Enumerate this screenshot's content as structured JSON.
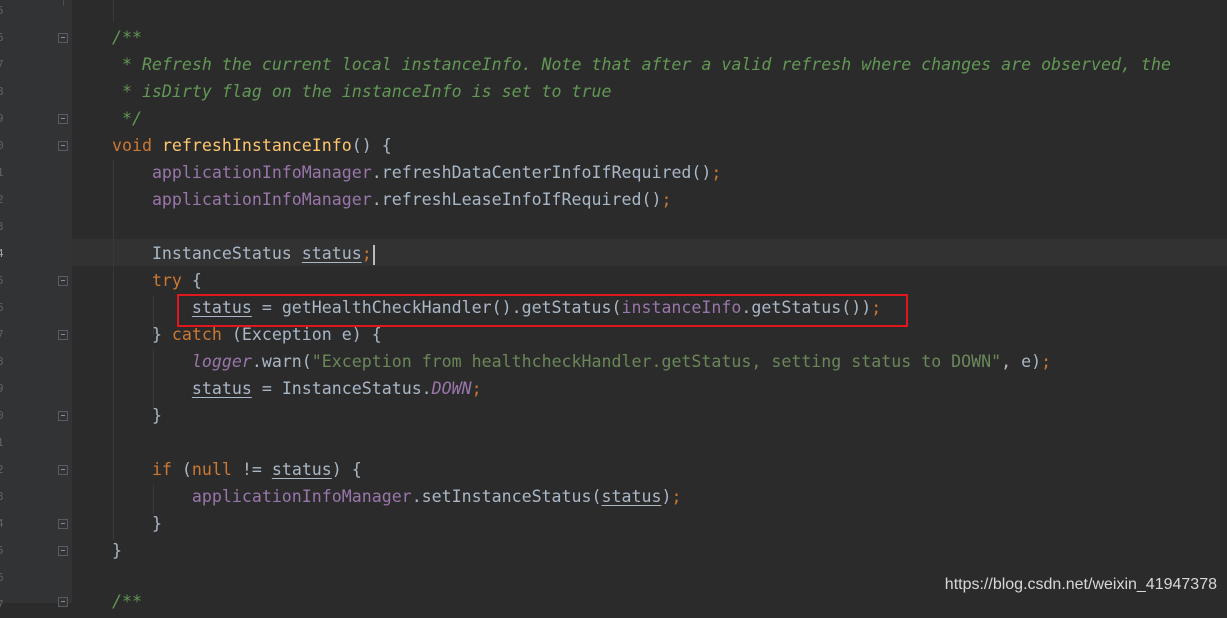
{
  "editor": {
    "gutter_numbers": [
      "5",
      "6",
      "7",
      "8",
      "9",
      "0",
      "1",
      "2",
      "3",
      "4",
      "5",
      "6",
      "7",
      "8",
      "9",
      "0",
      "1",
      "2",
      "3",
      "4",
      "5",
      "6",
      "7"
    ],
    "code": {
      "l1": "/**",
      "l2": " * Refresh the current local instanceInfo. Note that after a valid refresh where changes are observed, the",
      "l3": " * isDirty flag on the instanceInfo is set to true",
      "l4": " */",
      "l5_kw": "void",
      "l5_fn": "refreshInstanceInfo",
      "l5_rest": "() {",
      "l6_fld": "applicationInfoManager",
      "l6_rest": ".refreshDataCenterInfoIfRequired()",
      "l7_fld": "applicationInfoManager",
      "l7_rest": ".refreshLeaseInfoIfRequired()",
      "l9_type": "InstanceStatus ",
      "l9_var": "status",
      "l10_kw": "try",
      "l10_rest": " {",
      "l11_var": "status",
      "l11_mid": " = getHealthCheckHandler().getStatus(",
      "l11_fld": "instanceInfo",
      "l11_rest": ".getStatus())",
      "l12_a": "} ",
      "l12_kw": "catch",
      "l12_rest": " (Exception e) {",
      "l13_fld": "logger",
      "l13_a": ".warn(",
      "l13_str": "\"Exception from healthcheckHandler.getStatus, setting status to DOWN\"",
      "l13_b": ", e)",
      "l14_var": "status",
      "l14_mid": " = InstanceStatus.",
      "l14_fld": "DOWN",
      "l15": "}",
      "l17_kw1": "if",
      "l17_a": " (",
      "l17_kw2": "null",
      "l17_b": " != ",
      "l17_var": "status",
      "l17_rest": ") {",
      "l18_fld": "applicationInfoManager",
      "l18_a": ".setInstanceStatus(",
      "l18_var": "status",
      "l18_b": ")",
      "l19": "}",
      "l20": "}",
      "l22": "/**",
      "semicolon": ";",
      "comma": ","
    }
  },
  "watermark": "https://blog.csdn.net/weixin_41947378",
  "colors": {
    "background": "#2b2b2b",
    "keyword": "#cc7832",
    "field": "#9876aa",
    "method_decl": "#ffc66d",
    "string": "#6a8759",
    "doc_comment": "#629755",
    "highlight_box": "#e0171d"
  }
}
